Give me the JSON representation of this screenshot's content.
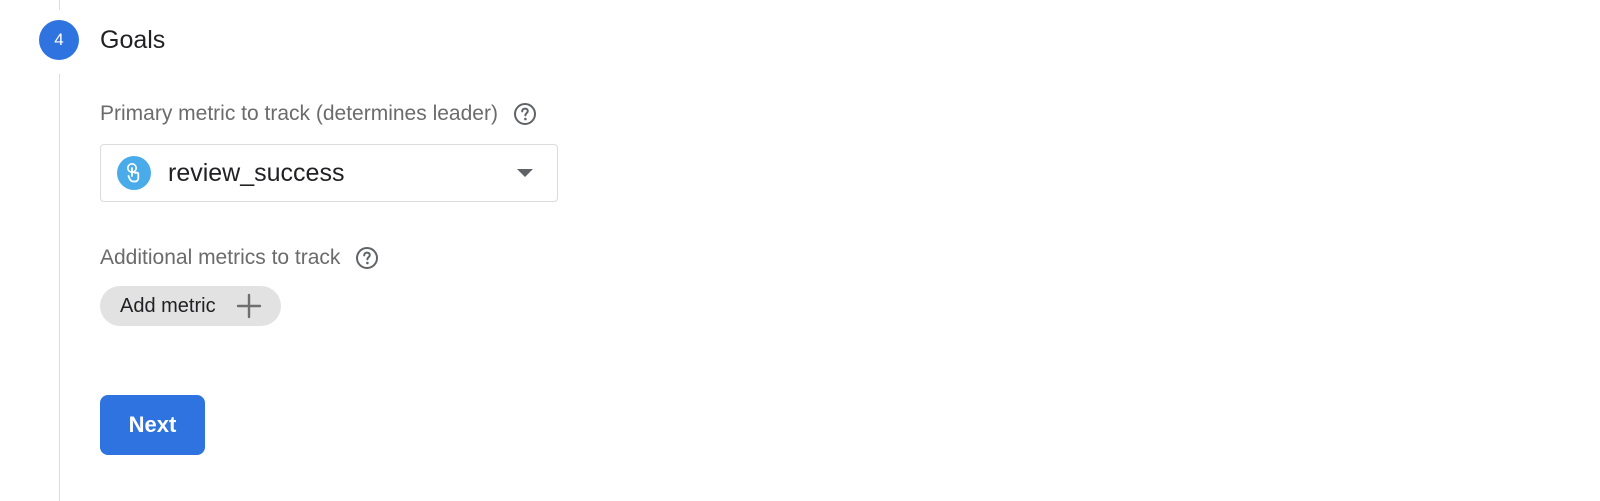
{
  "step": {
    "number": "4",
    "title": "Goals"
  },
  "primary_metric": {
    "label": "Primary metric to track (determines leader)",
    "help_icon": "help-circle-icon",
    "selected_value": "review_success",
    "event_icon": "touch-event-icon"
  },
  "additional_metrics": {
    "label": "Additional metrics to track",
    "help_icon": "help-circle-icon",
    "add_button_label": "Add metric",
    "add_icon": "plus-icon"
  },
  "actions": {
    "next_label": "Next"
  },
  "colors": {
    "accent": "#2f73e0",
    "event_icon_bg": "#4aabea",
    "chip_bg": "#e2e2e2",
    "label_text": "#6b6b6b"
  }
}
